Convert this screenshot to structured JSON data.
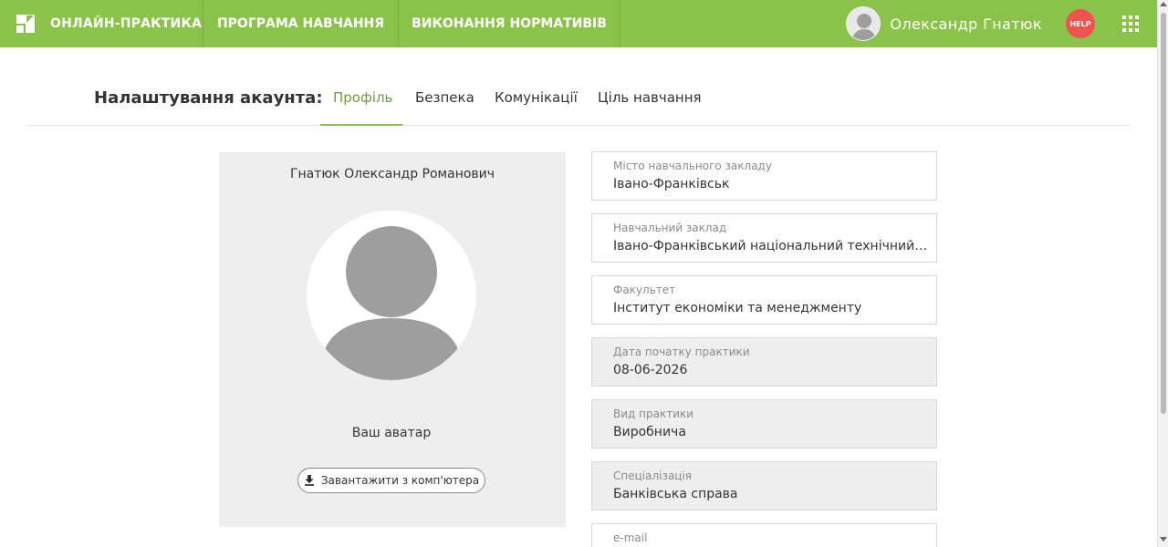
{
  "header": {
    "logo_text": "ОНЛАЙН-ПРАКТИКА",
    "nav": [
      "ПРОГРАМА НАВЧАННЯ",
      "ВИКОНАННЯ НОРМАТИВІВ"
    ],
    "user_name": "Олександр Гнатюк",
    "help_label": "HELP",
    "brand_color": "#8bc34a",
    "help_color": "#ef5350"
  },
  "settings": {
    "title": "Налаштування акаунта:",
    "tabs": [
      "Профіль",
      "Безпека",
      "Комунікації",
      "Ціль навчання"
    ],
    "active_tab": "Профіль"
  },
  "profile": {
    "full_name": "Гнатюк Олександр Романович",
    "avatar_caption": "Ваш аватар",
    "upload_label": "Завантажити з комп'ютера"
  },
  "fields": [
    {
      "label": "Місто навчального закладу",
      "value": "Івано-Франківськ"
    },
    {
      "label": "Навчальний заклад",
      "value": "Івано-Франківський національний технічний університет нафти і газу"
    },
    {
      "label": "Факультет",
      "value": "Інститут економіки та менеджменту"
    },
    {
      "label": "Дата початку практики",
      "value": "08-06-2026"
    },
    {
      "label": "Вид практики",
      "value": "Виробнича"
    },
    {
      "label": "Спеціалізація",
      "value": "Банківська справа"
    },
    {
      "label": "e-mail",
      "value": ""
    }
  ]
}
